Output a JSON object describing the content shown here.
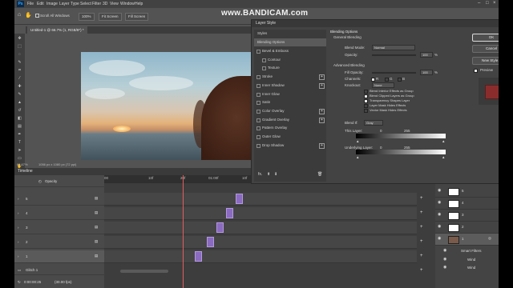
{
  "watermark": "www.BANDICAM.com",
  "menu": [
    "File",
    "Edit",
    "Image",
    "Layer",
    "Type",
    "Select",
    "Filter",
    "3D",
    "View",
    "Window",
    "Help"
  ],
  "options_bar": {
    "scroll_all": "Scroll All Windows",
    "zoom": "100%",
    "fit_screen": "Fit Screen",
    "fill_screen": "Fill Screen"
  },
  "document_tab": "Untitled-1 @ 66.7% (1, RGB/8*) *",
  "status": {
    "zoom": "66.67%",
    "size": "1056 px x 1080 px (72 ppi)"
  },
  "timeline": {
    "title": "Timeline",
    "opacity_label": "Opacity",
    "ruler_labels": [
      "00",
      "10f",
      "20f",
      "01:00f",
      "10f"
    ],
    "layers": [
      "5",
      "4",
      "3",
      "2",
      "1"
    ],
    "group": "Glitch 1",
    "timecode": "0:00:00:25",
    "fps": "(30.00 fps)"
  },
  "dialog": {
    "title": "Layer Style",
    "styles_header": "Styles",
    "blending_options_item": "Blending Options",
    "style_items": [
      {
        "label": "Bevel & Emboss",
        "checked": false,
        "plus": false
      },
      {
        "label": "Contour",
        "checked": false,
        "plus": false
      },
      {
        "label": "Texture",
        "checked": false,
        "plus": false
      },
      {
        "label": "Stroke",
        "checked": false,
        "plus": true
      },
      {
        "label": "Inner Shadow",
        "checked": false,
        "plus": true
      },
      {
        "label": "Inner Glow",
        "checked": false,
        "plus": false
      },
      {
        "label": "Satin",
        "checked": false,
        "plus": false
      },
      {
        "label": "Color Overlay",
        "checked": false,
        "plus": true
      },
      {
        "label": "Gradient Overlay",
        "checked": false,
        "plus": true
      },
      {
        "label": "Pattern Overlay",
        "checked": false,
        "plus": false
      },
      {
        "label": "Outer Glow",
        "checked": false,
        "plus": false
      },
      {
        "label": "Drop Shadow",
        "checked": false,
        "plus": true
      }
    ],
    "fx_label": "fx.",
    "blending": {
      "title": "Blending Options",
      "general": "General Blending",
      "blend_mode_label": "Blend Mode:",
      "blend_mode": "Normal",
      "opacity_label": "Opacity:",
      "opacity": "100",
      "percent": "%",
      "advanced": "Advanced Blending",
      "fill_opacity_label": "Fill Opacity:",
      "fill_opacity": "100",
      "channels_label": "Channels:",
      "channel_r": "R",
      "channel_g": "G",
      "channel_b": "B",
      "knockout_label": "Knockout:",
      "knockout": "None",
      "options": [
        {
          "label": "Blend Interior Effects as Group",
          "checked": false
        },
        {
          "label": "Blend Clipped Layers as Group",
          "checked": true
        },
        {
          "label": "Transparency Shapes Layer",
          "checked": true
        },
        {
          "label": "Layer Mask Hides Effects",
          "checked": false
        },
        {
          "label": "Vector Mask Hides Effects",
          "checked": false
        }
      ],
      "blend_if_label": "Blend If:",
      "blend_if": "Gray",
      "this_layer_label": "This Layer:",
      "this_layer_min": "0",
      "this_layer_max": "255",
      "underlying_label": "Underlying Layer:",
      "underlying_min": "0",
      "underlying_max": "255"
    },
    "buttons": {
      "ok": "OK",
      "cancel": "Cancel",
      "new_style": "New Style...",
      "preview": "Preview"
    }
  },
  "layers_panel": {
    "layers": [
      "5",
      "4",
      "3",
      "2",
      "1"
    ],
    "smart_filters": "Smart Filters",
    "filter_items": [
      "Wind",
      "Wind"
    ]
  },
  "colors": {
    "accent": "#31a8ff",
    "clip": "#8a6bc0",
    "playhead": "#e06060",
    "preview_swatch": "#8b2c2c"
  }
}
